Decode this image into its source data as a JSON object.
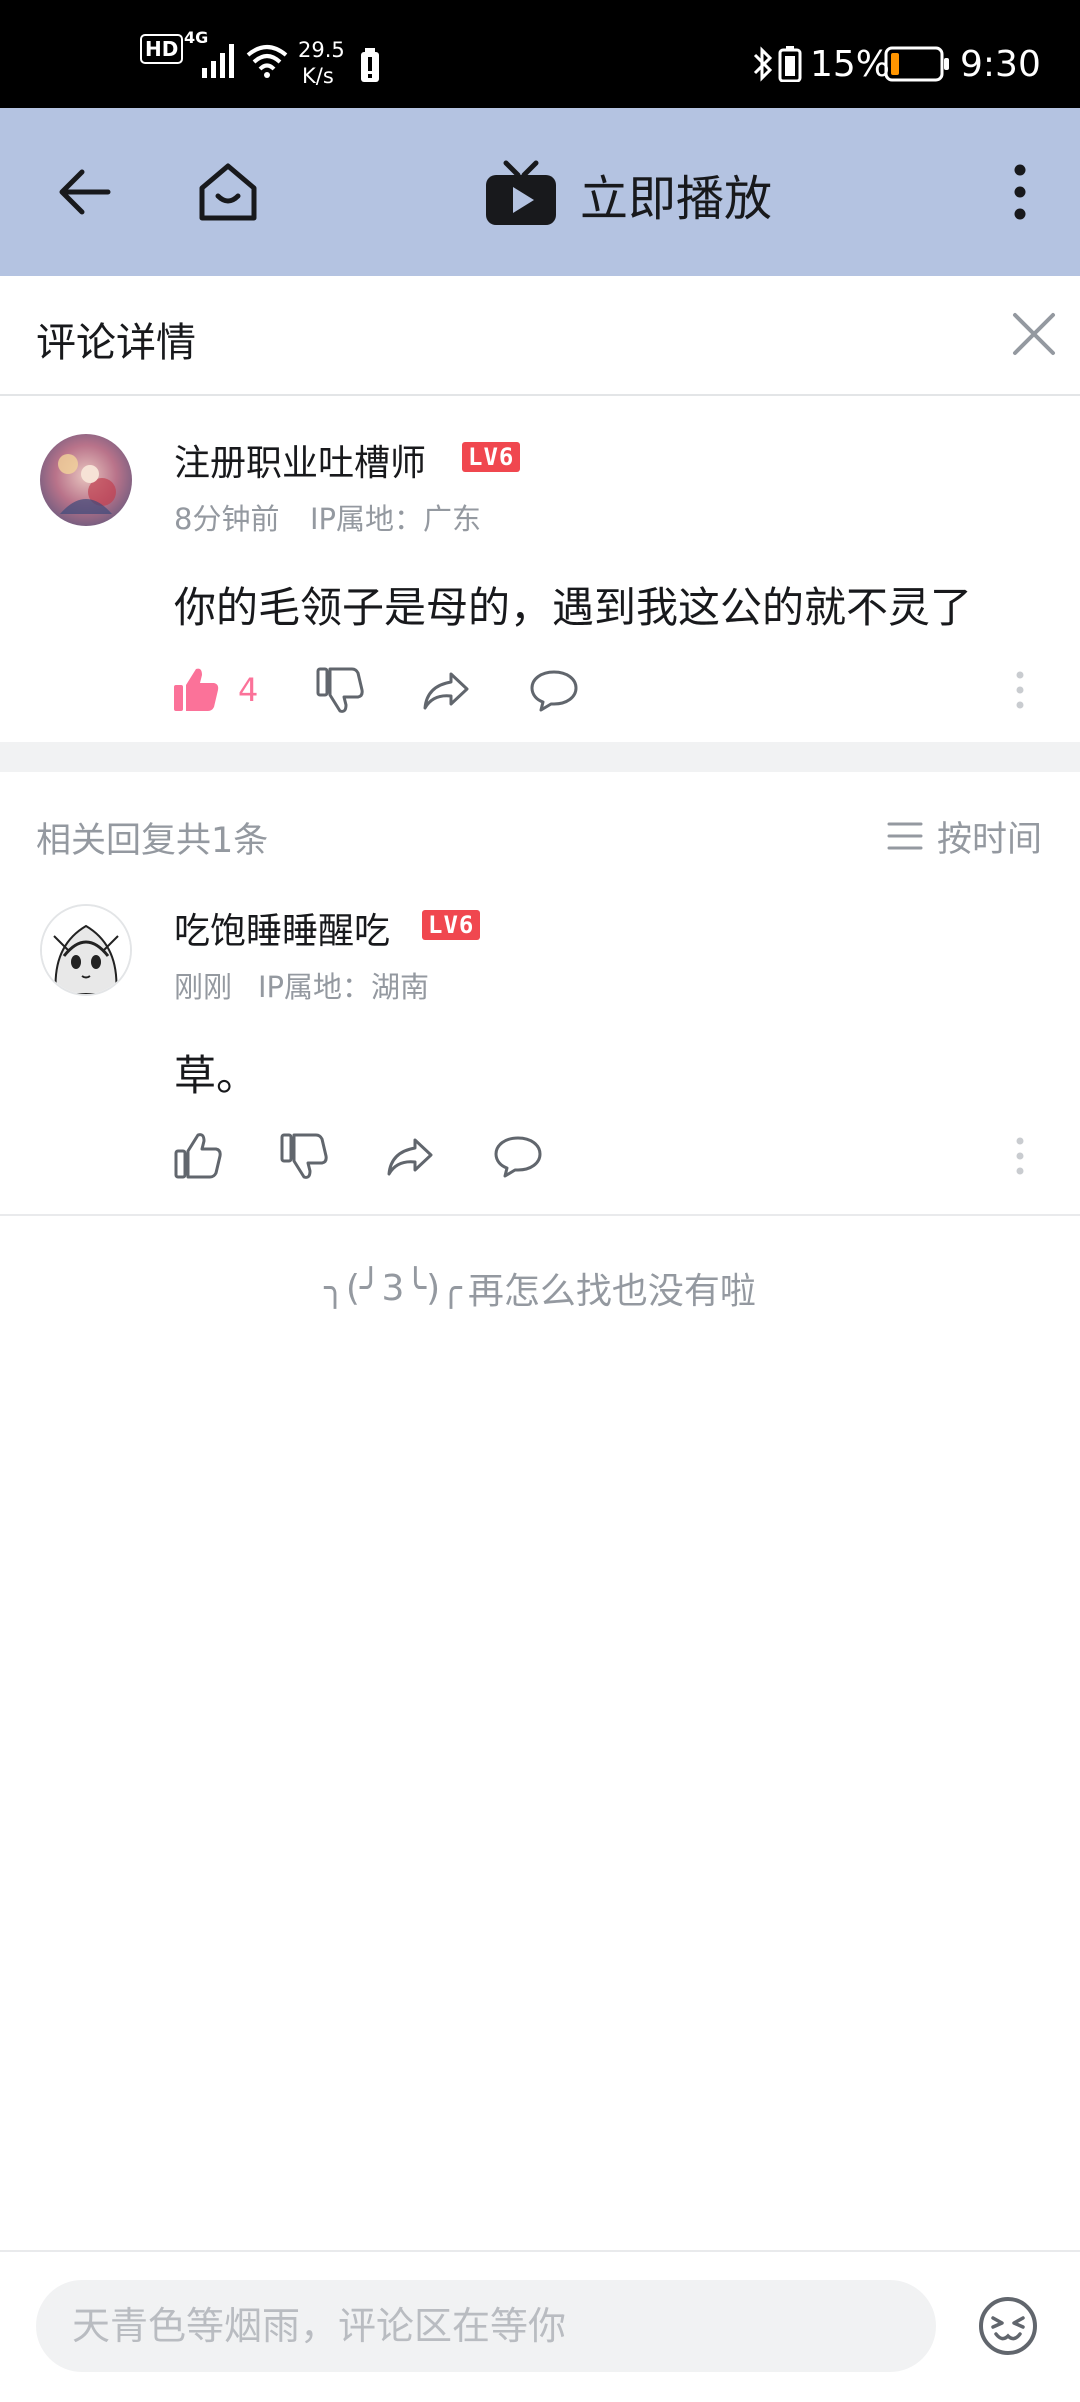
{
  "status_bar": {
    "hd": "HD",
    "network": "4G",
    "speed_value": "29.5",
    "speed_unit": "K/s",
    "battery_percent": "15%",
    "time": "9:30",
    "battery_color": "#ff9500"
  },
  "title_bar": {
    "play_label": "立即播放",
    "background": "#b4c3e1"
  },
  "comment_header": {
    "title": "评论详情"
  },
  "main_comment": {
    "username": "注册职业吐槽师",
    "level": "LV6",
    "time": "8分钟前",
    "ip": "IP属地：广东",
    "content": "你的毛领子是母的，遇到我这公的就不灵了",
    "likes": "4",
    "liked": true,
    "like_color": "#fb7299"
  },
  "replies": {
    "header": "相关回复共1条",
    "sort_label": "按时间",
    "items": [
      {
        "username": "吃饱睡睡醒吃",
        "level": "LV6",
        "time": "刚刚",
        "ip": "IP属地：湖南",
        "content": "草。"
      }
    ]
  },
  "end_message": {
    "kaomoji": "╮(╯3╰)╭",
    "text": "再怎么找也没有啦"
  },
  "input": {
    "placeholder": "天青色等烟雨，评论区在等你"
  },
  "icons": {
    "back": "back-arrow-icon",
    "home": "home-icon",
    "tv": "tv-play-icon",
    "more": "more-vertical-icon",
    "close": "close-icon",
    "like": "thumbs-up-icon",
    "dislike": "thumbs-down-icon",
    "share": "share-icon",
    "reply": "comment-bubble-icon",
    "sort": "list-sort-icon",
    "emoji": "emoji-icon"
  }
}
